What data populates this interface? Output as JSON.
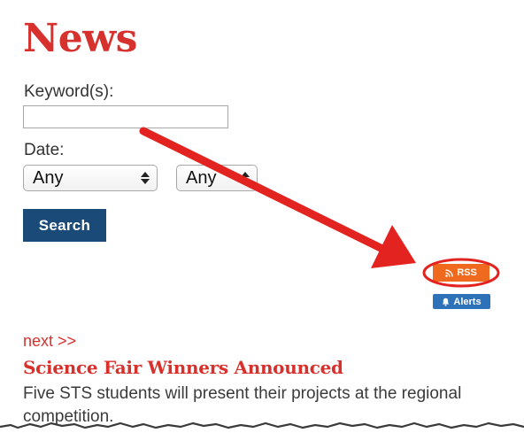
{
  "page": {
    "title": "News"
  },
  "form": {
    "keyword_label": "Keyword(s):",
    "keyword_value": "",
    "date_label": "Date:",
    "date_from_selected": "Any",
    "date_to_selected": "Any",
    "search_label": "Search"
  },
  "feeds": {
    "rss_label": "RSS",
    "alerts_label": "Alerts"
  },
  "pagination": {
    "next_label": "next >>"
  },
  "articles": [
    {
      "title": "Science Fair Winners Announced",
      "summary": "Five STS students will present their projects at the regional competition."
    }
  ],
  "icons": {
    "rss": "rss-icon",
    "alerts": "bell-icon",
    "select_arrows": "updown-arrows-icon",
    "annotation_arrow": "arrow-annotation",
    "annotation_circle": "circle-annotation"
  },
  "colors": {
    "brand_red": "#d7312e",
    "search_button": "#194a78",
    "rss_orange": "#ef6a1e",
    "alerts_blue": "#2d72b8",
    "annotation_red": "#e2231f"
  }
}
